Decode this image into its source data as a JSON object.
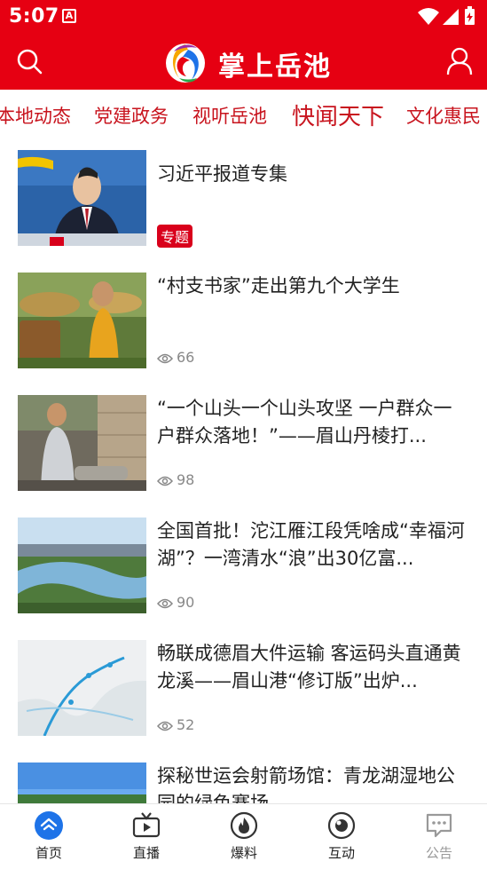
{
  "status": {
    "time": "5:07",
    "notif_glyph": "A"
  },
  "header": {
    "title": "掌上岳池"
  },
  "channels": [
    {
      "label": "本地动态",
      "active": false
    },
    {
      "label": "党建政务",
      "active": false
    },
    {
      "label": "视听岳池",
      "active": false
    },
    {
      "label": "快闻天下",
      "active": true
    },
    {
      "label": "文化惠民",
      "active": false
    }
  ],
  "news": [
    {
      "title": "习近平报道专集",
      "tag": "专题",
      "views": ""
    },
    {
      "title": "“村支书家”走出第九个大学生",
      "tag": "",
      "views": "66"
    },
    {
      "title": "“一个山头一个山头攻坚 一户群众一户群众落地！”——眉山丹棱打...",
      "tag": "",
      "views": "98"
    },
    {
      "title": "全国首批！沱江雁江段凭啥成“幸福河湖”？一湾清水“浪”出30亿富...",
      "tag": "",
      "views": "90"
    },
    {
      "title": "畅联成德眉大件运输 客运码头直通黄龙溪——眉山港“修订版”出炉...",
      "tag": "",
      "views": "52"
    },
    {
      "title": "探秘世运会射箭场馆：青龙湖湿地公园的绿色赛场",
      "tag": "",
      "views": ""
    }
  ],
  "tabbar": [
    {
      "label": "首页",
      "icon": "home-icon",
      "active": true
    },
    {
      "label": "直播",
      "icon": "tv-icon",
      "active": false
    },
    {
      "label": "爆料",
      "icon": "fire-icon",
      "active": false
    },
    {
      "label": "互动",
      "icon": "interaction-icon",
      "active": false
    },
    {
      "label": "公告",
      "icon": "notice-icon",
      "active": false
    }
  ],
  "colors": {
    "brand_red": "#e60012",
    "channel_red": "#c8141e",
    "tab_blue": "#1e73e8"
  }
}
